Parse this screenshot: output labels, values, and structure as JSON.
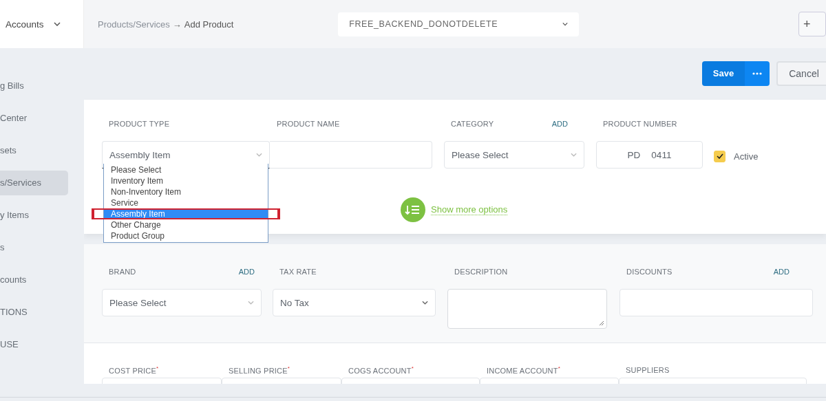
{
  "sidebar": {
    "header": {
      "label": "Accounts"
    },
    "items": [
      {
        "label": "g Bills",
        "selected": false
      },
      {
        "label": "Center",
        "selected": false
      },
      {
        "label": "sets",
        "selected": false
      },
      {
        "label": "s/Services",
        "selected": true
      },
      {
        "label": "y Items",
        "selected": false
      },
      {
        "label": "s",
        "selected": false
      },
      {
        "label": "counts",
        "selected": false
      },
      {
        "label": "TIONS",
        "selected": false
      },
      {
        "label": "USE",
        "selected": false
      }
    ]
  },
  "header": {
    "breadcrumb": {
      "parent": "Products/Services",
      "arrow": "→",
      "current": "Add Product"
    },
    "environment_select": {
      "value": "FREE_BACKEND_DONOTDELETE"
    },
    "plus_button": "+"
  },
  "actions": {
    "save": "Save",
    "cancel": "Cancel"
  },
  "basic_section": {
    "fields": [
      {
        "kind": "select",
        "label": "PRODUCT TYPE",
        "value": "Assembly Item",
        "expanded": true,
        "options": [
          {
            "label": "Please Select",
            "selected": false
          },
          {
            "label": "Inventory Item",
            "selected": false
          },
          {
            "label": "Non-Inventory Item",
            "selected": false
          },
          {
            "label": "Service",
            "selected": false
          },
          {
            "label": "Assembly Item",
            "selected": true
          },
          {
            "label": "Other Charge",
            "selected": false
          },
          {
            "label": "Product Group",
            "selected": false
          }
        ]
      },
      {
        "kind": "input",
        "label": "PRODUCT NAME"
      },
      {
        "kind": "select",
        "label": "CATEGORY",
        "add_link": "ADD",
        "value": "Please Select",
        "expanded": false
      },
      {
        "kind": "number",
        "label": "PRODUCT NUMBER",
        "prefix": "PD",
        "value": "0411"
      },
      {
        "kind": "checkbox",
        "label": "Active",
        "checked": true
      }
    ],
    "more_options_link": "Show more options"
  },
  "details_section": {
    "fields": [
      {
        "kind": "select",
        "label": "BRAND",
        "add_link": "ADD",
        "value": "Please Select",
        "expanded": false
      },
      {
        "kind": "select",
        "label": "TAX RATE",
        "value": "No Tax",
        "expanded": false
      },
      {
        "kind": "textarea",
        "label": "DESCRIPTION"
      },
      {
        "kind": "input",
        "label": "DISCOUNTS",
        "add_link": "ADD"
      }
    ]
  },
  "pricing_section": {
    "fields": [
      {
        "kind": "input",
        "label": "COST PRICE$^{*}$"
      },
      {
        "kind": "input",
        "label": "SELLING PRICE$^{*}$"
      },
      {
        "kind": "input",
        "label": "COGS ACCOUNT$^{*}$"
      },
      {
        "kind": "input",
        "label": "INCOME ACCOUNT$^{*}$"
      },
      {
        "kind": "input",
        "label": "SUPPLIERS"
      }
    ]
  }
}
